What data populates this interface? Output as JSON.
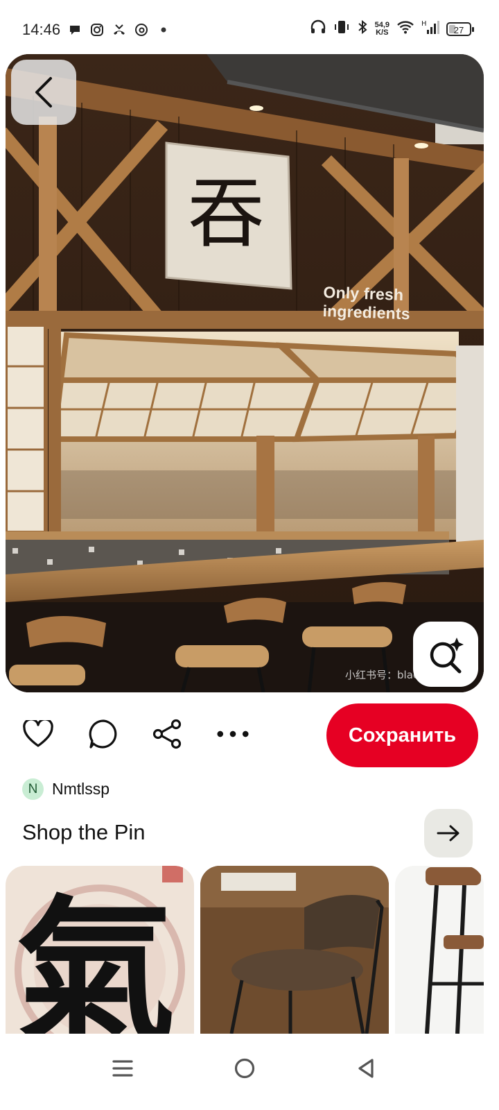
{
  "status_bar": {
    "time": "14:46",
    "net_speed_value": "54,9",
    "net_speed_unit": "K/S",
    "battery": "27",
    "battery_level": 0.27,
    "left_icons": [
      "message-icon",
      "instagram-icon",
      "missed-call-icon",
      "threads-icon",
      "dot-icon"
    ],
    "right_icons": [
      "headphones-icon",
      "vibrate-icon",
      "bluetooth-icon",
      "wifi-icon",
      "signal-icon",
      "battery-icon"
    ]
  },
  "pin": {
    "sign_text": "Only fresh ingredients",
    "kanji": "吞",
    "watermark": "小红书号：blac",
    "back_icon": "chevron-left-icon",
    "lens_icon": "visual-search-icon"
  },
  "actions": {
    "like_icon": "heart-icon",
    "comment_icon": "comment-icon",
    "share_icon": "share-icon",
    "more_icon": "more-icon",
    "save_label": "Сохранить"
  },
  "author": {
    "initial": "N",
    "name": "Nmtlssp"
  },
  "shop": {
    "title": "Shop the Pin",
    "arrow_icon": "arrow-right-icon",
    "items": [
      {
        "kanji": "氣"
      },
      {
        "kind": "wooden-stool"
      },
      {
        "kind": "bar-chair"
      }
    ]
  },
  "colors": {
    "save_button": "#e60023",
    "avatar_bg": "#c9edd4",
    "arrow_button_bg": "#e9e9e4"
  },
  "navbar": {
    "icons": [
      "menu-icon",
      "home-icon",
      "back-icon"
    ]
  }
}
